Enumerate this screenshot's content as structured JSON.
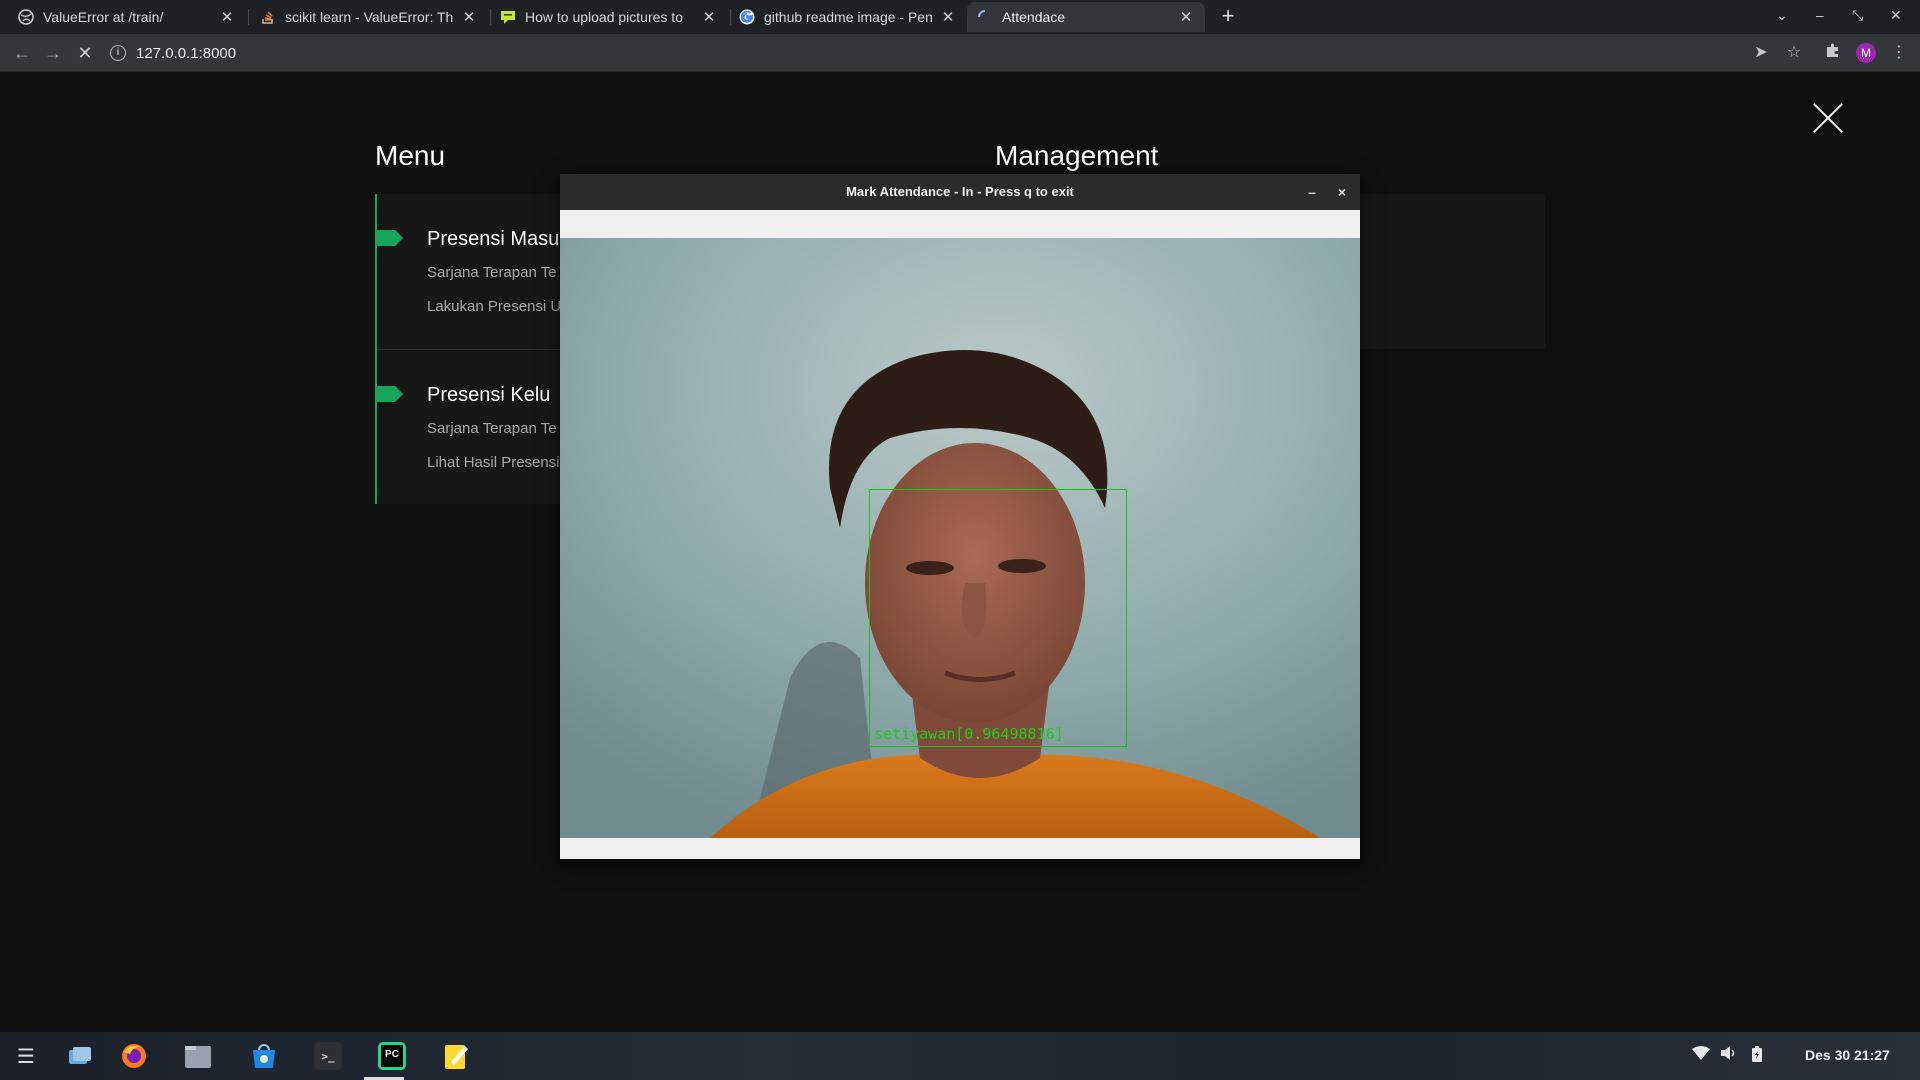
{
  "browser": {
    "tabs": [
      {
        "title": "ValueError at /train/"
      },
      {
        "title": "scikit learn - ValueError: Th"
      },
      {
        "title": "How to upload pictures to"
      },
      {
        "title": "github readme image - Pen"
      },
      {
        "title": "Attendace"
      }
    ],
    "url": "127.0.0.1:8000",
    "profile_initial": "M"
  },
  "page": {
    "menu_heading": "Menu",
    "management_heading": "Management",
    "menu_items": [
      {
        "title": "Presensi Masu",
        "line1": "Sarjana Terapan Te",
        "line2": "Lakukan Presensi Ur"
      },
      {
        "title": "Presensi Kelu",
        "line1": "Sarjana Terapan Te",
        "line2": "Lihat Hasil Presensi"
      }
    ]
  },
  "camera_window": {
    "title": "Mark Attendance - In - Press q to exit",
    "minimize_glyph": "–",
    "close_glyph": "×",
    "face_label": "setiyawan[0.96498816]"
  },
  "taskbar": {
    "clock": "Des 30  21:27"
  },
  "colors": {
    "accent": "#1aa35a",
    "face_box": "#19c21a"
  }
}
